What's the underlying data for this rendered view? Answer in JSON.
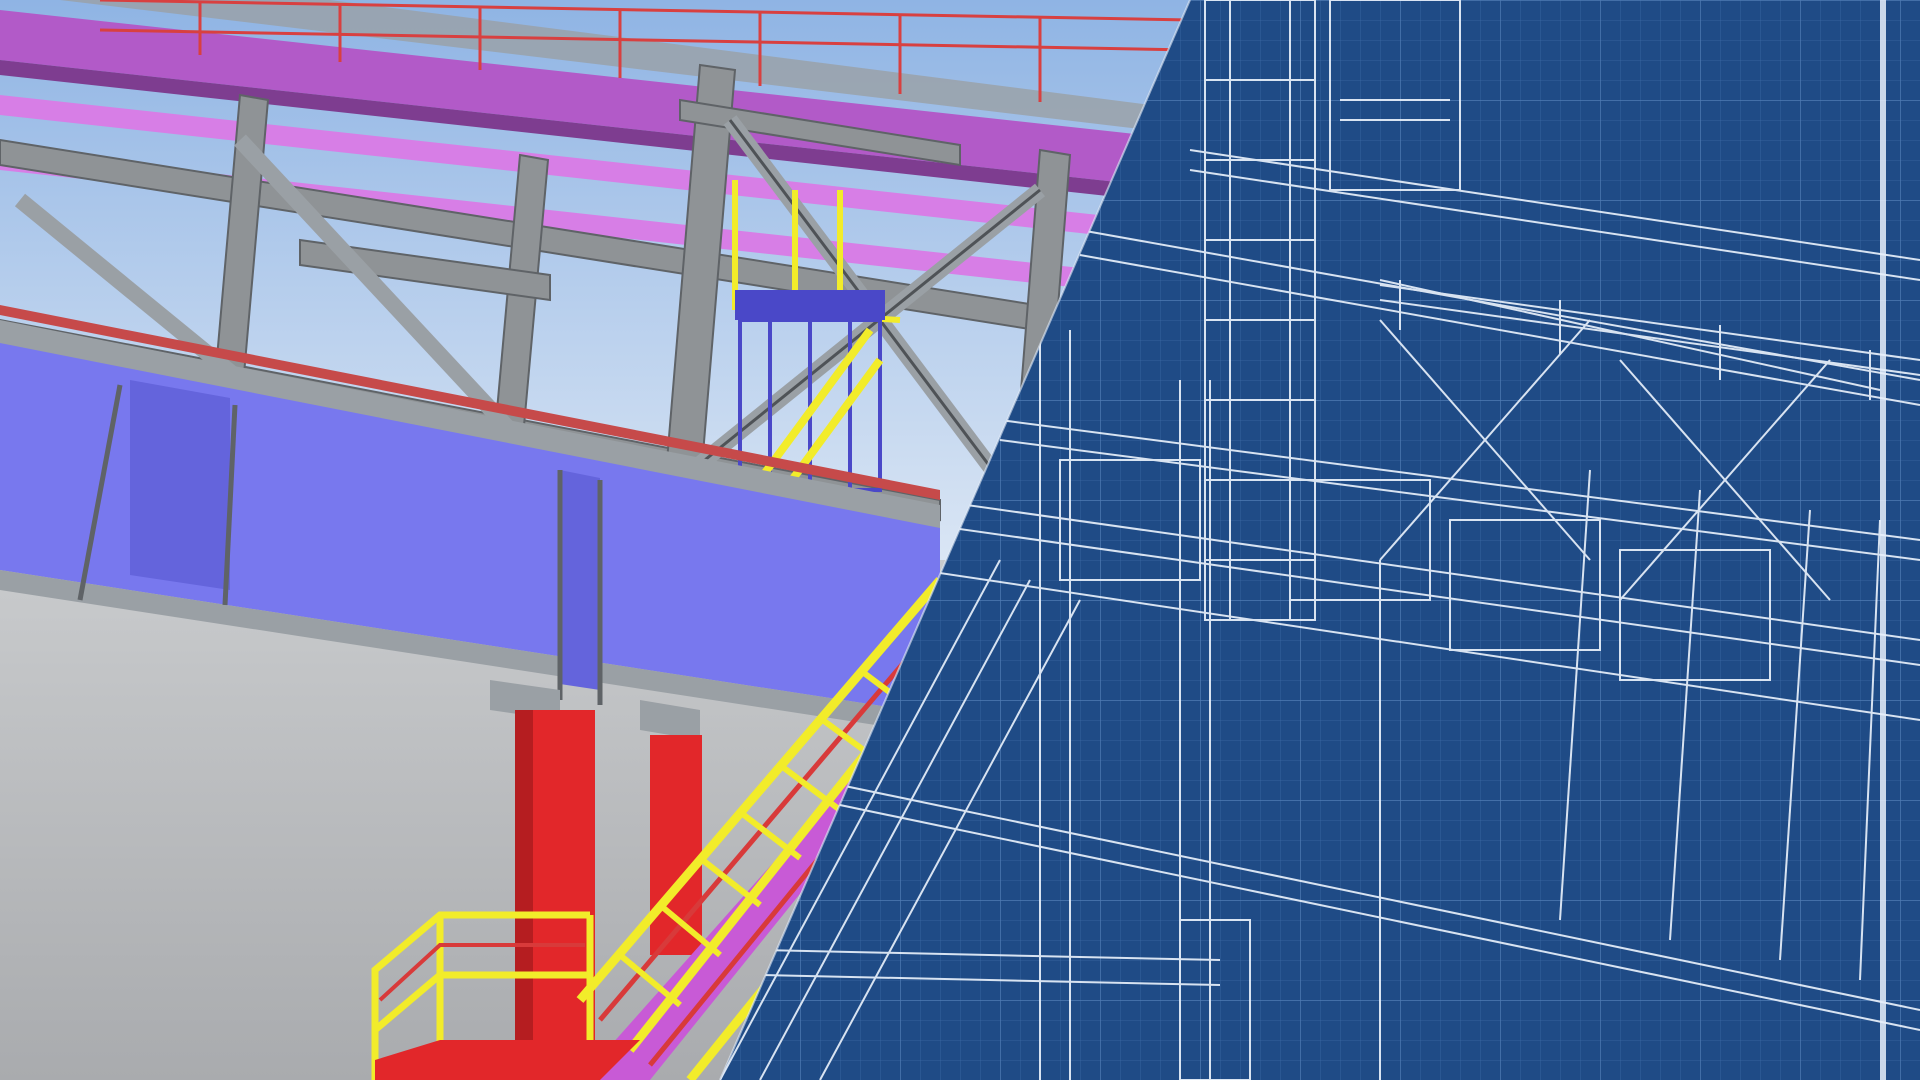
{
  "scene": {
    "title": "",
    "colors": {
      "sky_top": "#8fb4e4",
      "sky_bottom": "#e2ebf6",
      "ground": "#b9bbbe",
      "steel_grey": "#8f9396",
      "girder_blue": "#7878ee",
      "member_magenta": "#c85ad6",
      "column_red": "#e2272a",
      "rail_yellow": "#f2ec2a",
      "rail_red": "#d83a3a",
      "blueprint_bg": "#1f4b86",
      "blueprint_grid": "#3c69a3",
      "blueprint_line": "#e8f0fb"
    },
    "icons": [
      "steel-structure-render",
      "blueprint-drawing"
    ]
  }
}
